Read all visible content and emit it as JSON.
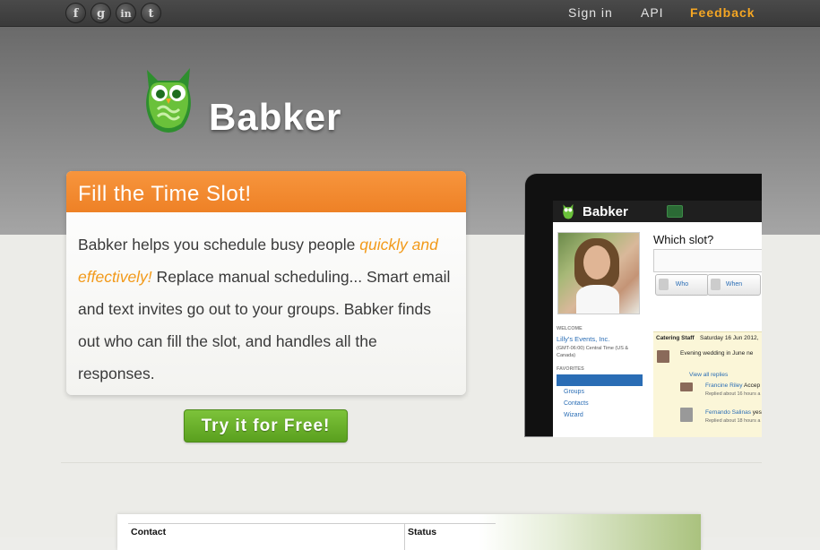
{
  "topbar": {
    "social": [
      {
        "icon": "facebook-icon",
        "glyph": "f"
      },
      {
        "icon": "google-icon",
        "glyph": "g"
      },
      {
        "icon": "linkedin-icon",
        "glyph": "in"
      },
      {
        "icon": "twitter-icon",
        "glyph": "t"
      }
    ],
    "links": {
      "signin": "Sign in",
      "api": "API",
      "feedback": "Feedback"
    }
  },
  "brand": {
    "name": "Babker"
  },
  "hero": {
    "title": "Fill the Time Slot!",
    "body_start": "Babker helps you schedule busy people ",
    "body_highlight": "quickly and effectively!",
    "body_end": " Replace manual scheduling... Smart email and text invites go out to your groups. Babker finds out who can fill the slot, and handles all the responses.",
    "cta": "Try it for Free!"
  },
  "preview": {
    "brand": "Babker",
    "question": "Which slot?",
    "who": "Who",
    "when": "When",
    "welcome_label": "WELCOME",
    "account": "Lilly's Events, Inc.",
    "timezone": "(GMT-06:00) Central Time (US & Canada)",
    "favorites_label": "FAVORITES",
    "menu": [
      "Requests",
      "Groups",
      "Contacts",
      "Wizard"
    ],
    "feed_header": "Catering Staff",
    "feed_date": "Saturday 16 Jun 2012,",
    "feed_desc": "Evening wedding in June ne",
    "view_replies": "View all replies",
    "replies": [
      {
        "name": "Francine Riley",
        "status": "Accep",
        "time": "Replied about 16 hours a"
      },
      {
        "name": "Fernando Salinas",
        "status": "yes",
        "time": "Replied about 18 hours a"
      }
    ]
  },
  "table": {
    "headers": [
      "Contact",
      "Status"
    ]
  },
  "colors": {
    "accent": "#f29a1a",
    "orange_header": "#f08a2f",
    "green_button": "#6cb22b",
    "link_blue": "#2a6db5"
  }
}
